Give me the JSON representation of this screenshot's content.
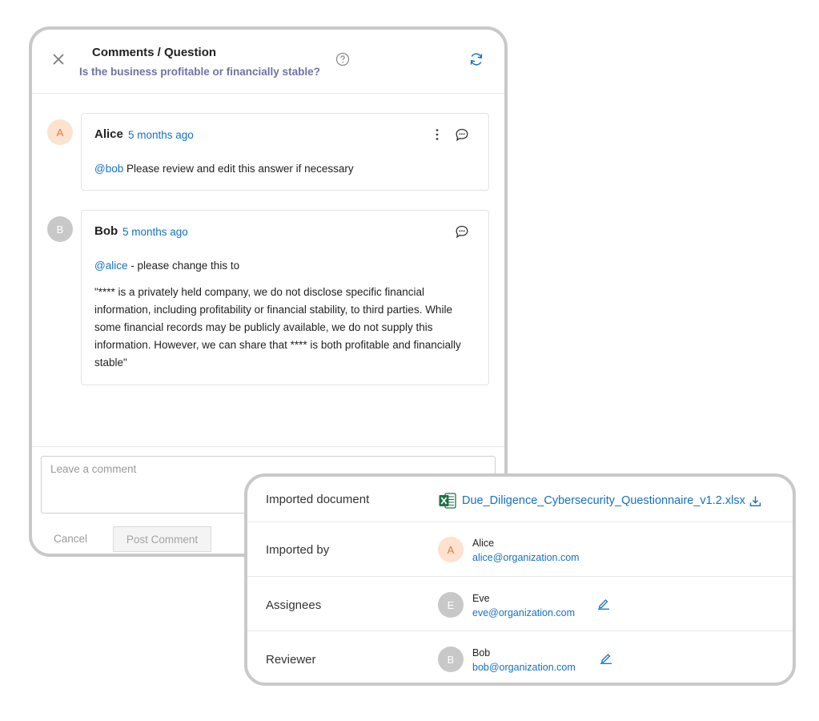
{
  "comments_panel": {
    "title": "Comments / Question",
    "question": "Is the business profitable or financially stable?",
    "icons": {
      "close": "close-icon",
      "help": "help-icon",
      "refresh": "refresh-icon"
    },
    "comments": [
      {
        "avatar_initial": "A",
        "author": "Alice",
        "time": "5 months ago",
        "mention": "@bob",
        "text": " Please review and edit this answer if necessary"
      },
      {
        "avatar_initial": "B",
        "author": "Bob",
        "time": "5 months ago",
        "mention": "@alice",
        "text": " - please change this to",
        "quote": "\"**** is a privately held company, we do not disclose specific financial information, including profitability or financial stability, to third parties. While some financial records may be publicly available, we do not supply this information. However, we can share that **** is both profitable and financially stable\""
      }
    ],
    "input": {
      "placeholder": "Leave a comment",
      "value": ""
    },
    "cancel_label": "Cancel",
    "post_label": "Post Comment"
  },
  "doc_panel": {
    "imported_document": {
      "label": "Imported document",
      "filename": "Due_Diligence_Cybersecurity_Questionnaire_v1.2.xlsx",
      "icon": "excel-icon"
    },
    "imported_by": {
      "label": "Imported by",
      "initial": "A",
      "name": "Alice",
      "email": "alice@organization.com"
    },
    "assignees": {
      "label": "Assignees",
      "initial": "E",
      "name": "Eve",
      "email": "eve@organization.com"
    },
    "reviewer": {
      "label": "Reviewer",
      "initial": "B",
      "name": "Bob",
      "email": "bob@organization.com"
    }
  },
  "colors": {
    "link_blue": "#1570c4",
    "question_purple": "#6f72a6",
    "avatar_orange_bg": "#fde2cf",
    "avatar_orange_text": "#e07a3c",
    "avatar_gray": "#c8c8c8",
    "excel_green": "#1e7145"
  }
}
